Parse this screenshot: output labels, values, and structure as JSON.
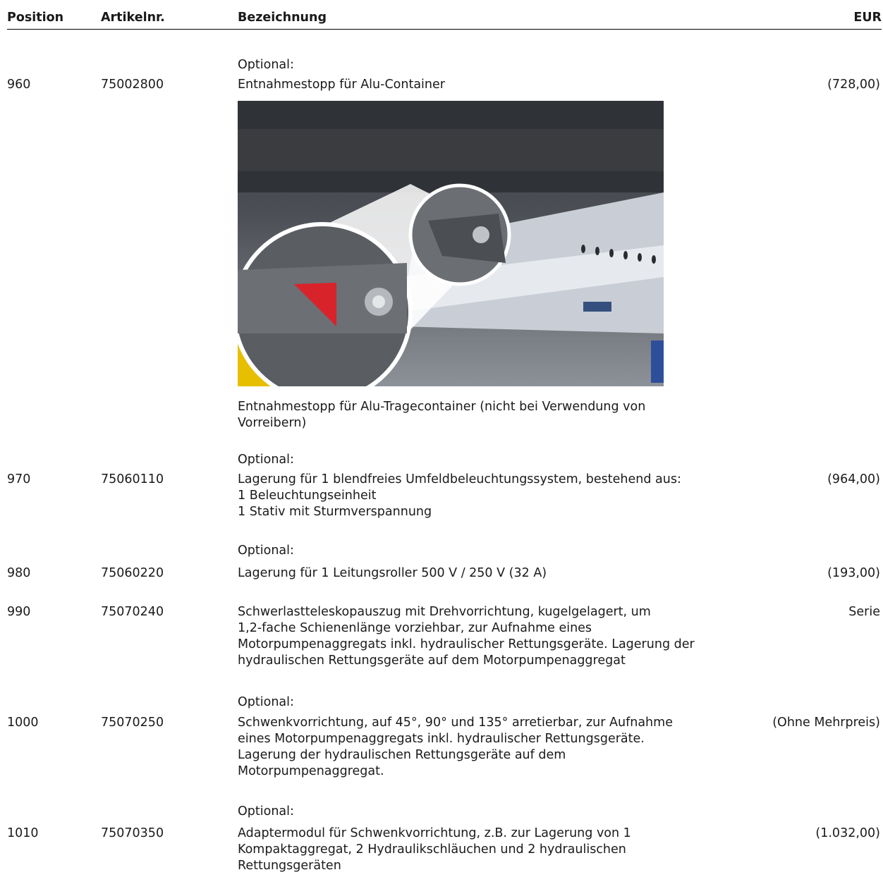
{
  "header": {
    "position": "Position",
    "artikelnr": "Artikelnr.",
    "bezeichnung": "Bezeichnung",
    "eur": "EUR"
  },
  "rows": [
    {
      "optional_label": "Optional:",
      "position": "960",
      "artikelnr": "75002800",
      "description": "Entnahmestopp für Alu-Container",
      "price": "(728,00)",
      "image_caption": "Entnahmestopp für Alu-Tragecontainer (nicht bei Verwendung von\nVorreibern)"
    },
    {
      "optional_label": "Optional:",
      "position": "970",
      "artikelnr": "75060110",
      "description": "Lagerung für 1 blendfreies Umfeldbeleuchtungssystem, bestehend aus:\n1 Beleuchtungseinheit\n1 Stativ mit Sturmverspannung",
      "price": "(964,00)"
    },
    {
      "optional_label": "Optional:",
      "position": "980",
      "artikelnr": "75060220",
      "description": "Lagerung für 1 Leitungsroller 500 V / 250 V (32 A)",
      "price": "(193,00)"
    },
    {
      "position": "990",
      "artikelnr": "75070240",
      "description": "Schwerlastteleskopauszug mit Drehvorrichtung, kugelgelagert, um\n1,2-fache Schienenlänge vorziehbar, zur Aufnahme eines\nMotorpumpenaggregats inkl. hydraulischer Rettungsgeräte. Lagerung der\nhydraulischen Rettungsgeräte auf dem Motorpumpenaggregat",
      "price": "Serie"
    },
    {
      "optional_label": "Optional:",
      "position": "1000",
      "artikelnr": "75070250",
      "description": "Schwenkvorrichtung, auf 45°, 90° und 135° arretierbar, zur Aufnahme\neines Motorpumpenaggregats inkl. hydraulischer Rettungsgeräte.\nLagerung der hydraulischen Rettungsgeräte auf dem\nMotorpumpenaggregat.",
      "price": "(Ohne Mehrpreis)"
    },
    {
      "optional_label": "Optional:",
      "position": "1010",
      "artikelnr": "75070350",
      "description": "Adaptermodul für Schwenkvorrichtung, z.B. zur Lagerung von 1\nKompaktaggregat, 2 Hydraulikschläuchen und 2 hydraulischen\nRettungsgeräten",
      "price": "(1.032,00)"
    }
  ]
}
